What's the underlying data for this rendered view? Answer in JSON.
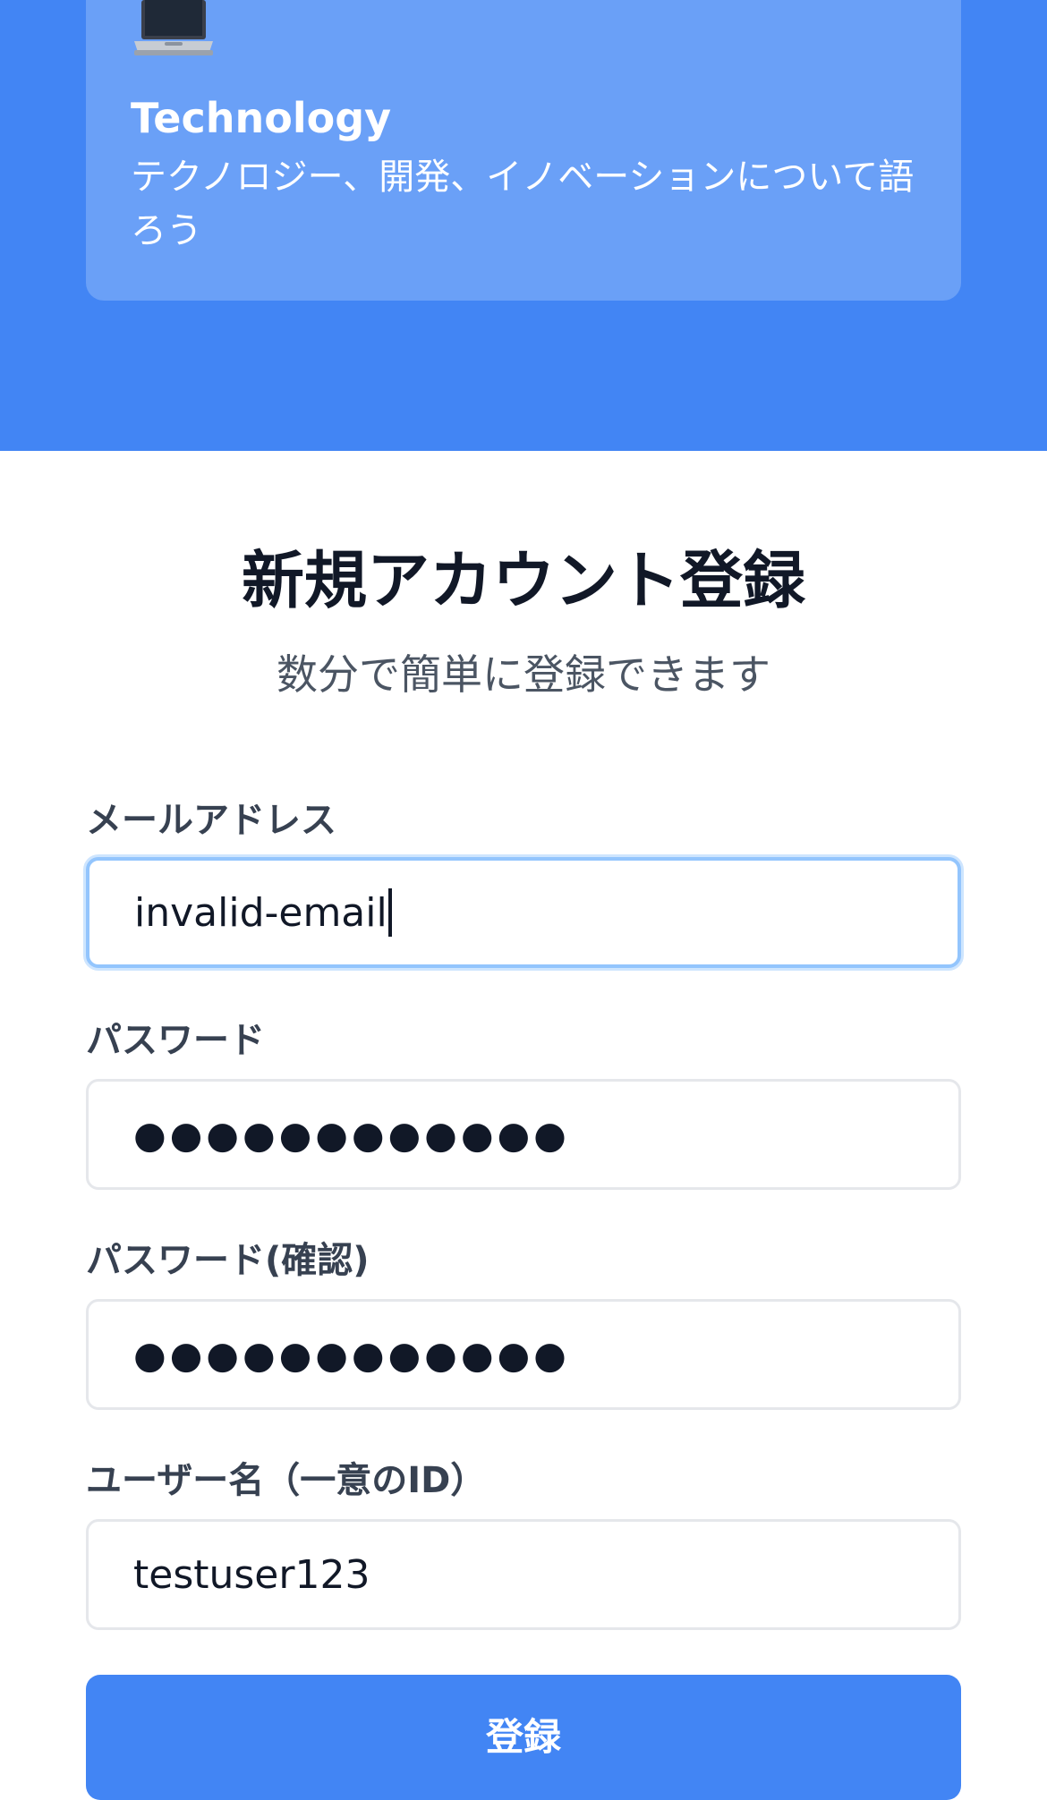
{
  "category_card": {
    "icon": "laptop-icon",
    "title": "Technology",
    "description": "テクノロジー、開発、イノベーションについて語ろう"
  },
  "signup": {
    "title": "新規アカウント登録",
    "subtitle": "数分で簡単に登録できます",
    "fields": {
      "email": {
        "label": "メールアドレス",
        "value": "invalid-email"
      },
      "password": {
        "label": "パスワード",
        "value": "●●●●●●●●●●●●"
      },
      "password_confirm": {
        "label": "パスワード(確認)",
        "value": "●●●●●●●●●●●●"
      },
      "username": {
        "label": "ユーザー名（一意のID）",
        "value": "testuser123"
      }
    },
    "submit_label": "登録"
  },
  "colors": {
    "brand_blue": "#4285f4",
    "card_blue": "#6aa0f7",
    "focus_ring": "#93c5fd",
    "title_text": "#111827",
    "subtitle_text": "#4b5563",
    "label_text": "#374151",
    "input_border": "#e5e7eb"
  }
}
